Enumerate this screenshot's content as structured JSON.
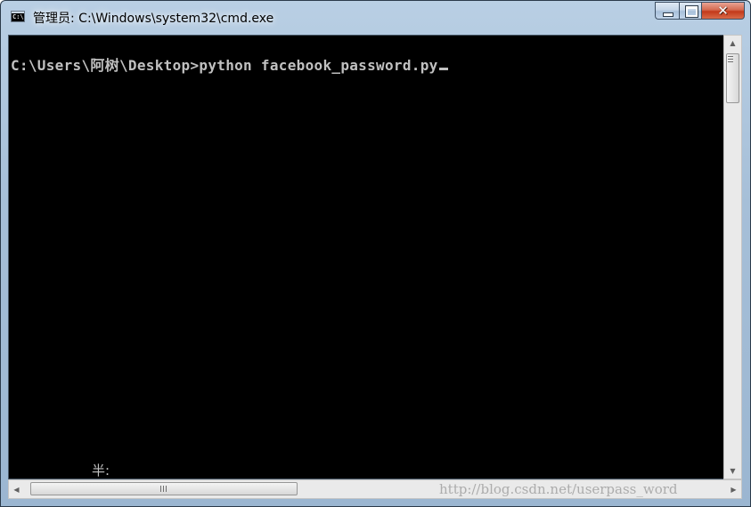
{
  "window": {
    "title": "管理员: C:\\Windows\\system32\\cmd.exe",
    "app_icon": "cmd-icon",
    "controls": {
      "minimize_icon": "minimize-icon",
      "maximize_icon": "maximize-icon",
      "close_icon": "close-icon",
      "close_glyph": "✕"
    }
  },
  "console": {
    "prompt": "C:\\Users\\阿树\\Desktop>",
    "command": "python facebook_password.py",
    "ime_status": "半:",
    "background": "#000000",
    "foreground": "#c0c0c0"
  },
  "scrollbars": {
    "vertical": {
      "up_arrow": "▲",
      "down_arrow": "▼"
    },
    "horizontal": {
      "left_arrow": "◀",
      "right_arrow": "▶"
    }
  },
  "watermark": {
    "text": "http://blog.csdn.net/userpass_word"
  }
}
